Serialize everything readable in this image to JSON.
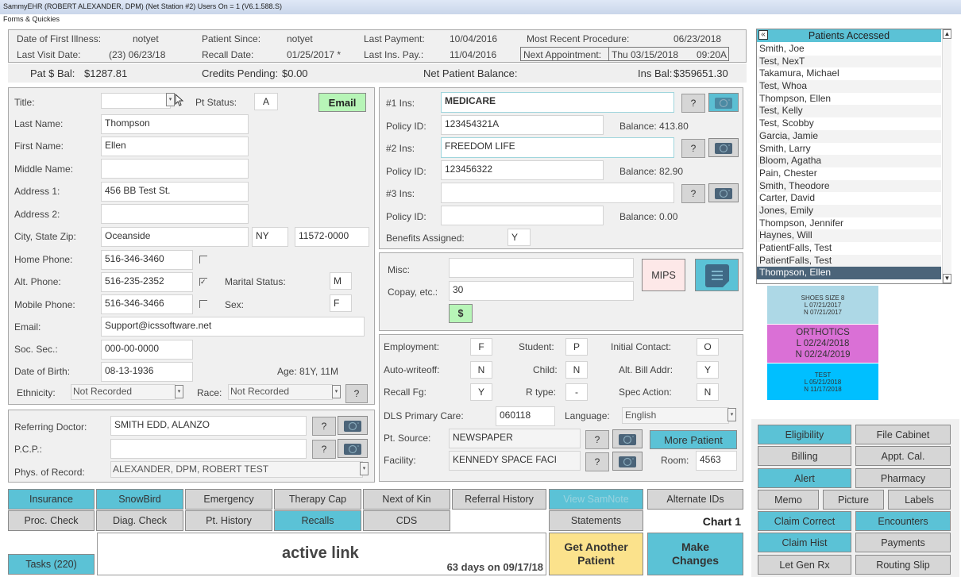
{
  "window": {
    "title": "SammyEHR (ROBERT ALEXANDER, DPM) (Net Station #2)  Users On = 1 (V6.1.588.S)",
    "menu": "Forms & Quickies"
  },
  "summary": {
    "date_first_illness_label": "Date of First Illness:",
    "date_first_illness": "notyet",
    "patient_since_label": "Patient Since:",
    "patient_since": "notyet",
    "last_payment_label": "Last Payment:",
    "last_payment": "10/04/2016",
    "most_recent_proc_label": "Most Recent Procedure:",
    "most_recent_proc": "06/23/2018",
    "last_visit_label": "Last Visit Date:",
    "last_visit": "(23) 06/23/18",
    "recall_date_label": "Recall Date:",
    "recall_date": "01/25/2017 *",
    "last_ins_pay_label": "Last Ins. Pay.:",
    "last_ins_pay": "11/04/2016",
    "next_appt_label": "Next Appointment:",
    "next_appt_date": "Thu 03/15/2018",
    "next_appt_time": "09:20A"
  },
  "balances": {
    "pat_bal_label": "Pat $ Bal:",
    "pat_bal": "$1287.81",
    "credits_label": "Credits Pending:",
    "credits": "$0.00",
    "net_label": "Net Patient Balance:",
    "ins_bal_label": "Ins Bal:",
    "ins_bal": "$359651.30"
  },
  "demographics": {
    "title_label": "Title:",
    "title_value": "",
    "pt_status_label": "Pt Status:",
    "pt_status": "A",
    "email_button": "Email",
    "last_name_label": "Last Name:",
    "last_name": "Thompson",
    "first_name_label": "First Name:",
    "first_name": "Ellen",
    "middle_name_label": "Middle Name:",
    "middle_name": "",
    "address1_label": "Address 1:",
    "address1": "456 BB Test St.",
    "address2_label": "Address 2:",
    "address2": "",
    "city_label": "City, State Zip:",
    "city": "Oceanside",
    "state": "NY",
    "zip": "11572-0000",
    "home_phone_label": "Home Phone:",
    "home_phone": "516-346-3460",
    "home_phone_checked": false,
    "alt_phone_label": "Alt. Phone:",
    "alt_phone": "516-235-2352",
    "alt_phone_checked": true,
    "marital_label": "Marital Status:",
    "marital": "M",
    "mobile_phone_label": "Mobile Phone:",
    "mobile_phone": "516-346-3466",
    "mobile_phone_checked": false,
    "sex_label": "Sex:",
    "sex": "F",
    "email_label": "Email:",
    "email": "Support@icssoftware.net",
    "ssn_label": "Soc. Sec.:",
    "ssn": "000-00-0000",
    "dob_label": "Date of Birth:",
    "dob": "08-13-1936",
    "age": "Age: 81Y, 11M",
    "ethnicity_label": "Ethnicity:",
    "ethnicity": "Not Recorded",
    "race_label": "Race:",
    "race": "Not Recorded",
    "help": "?"
  },
  "doctors": {
    "referring_label": "Referring Doctor:",
    "referring": "SMITH EDD, ALANZO",
    "pcp_label": "P.C.P.:",
    "pcp": "",
    "phys_label": "Phys. of Record:",
    "phys": "ALEXANDER, DPM, ROBERT  TEST",
    "help": "?"
  },
  "insurance": {
    "ins1_label": "#1 Ins:",
    "ins1": "MEDICARE",
    "policy1_label": "Policy ID:",
    "policy1": "123454321A",
    "balance1": "Balance: 413.80",
    "ins2_label": "#2 Ins:",
    "ins2": "FREEDOM LIFE",
    "policy2_label": "Policy ID:",
    "policy2": "123456322",
    "balance2": "Balance: 82.90",
    "ins3_label": "#3 Ins:",
    "ins3": "",
    "policy3_label": "Policy ID:",
    "policy3": "",
    "balance3": "Balance: 0.00",
    "benefits_label": "Benefits Assigned:",
    "benefits": "Y",
    "help": "?"
  },
  "misc": {
    "misc_label": "Misc:",
    "misc": "",
    "copay_label": "Copay, etc.:",
    "copay": "30",
    "dollar_button": "$",
    "mips_button": "MIPS"
  },
  "flags": {
    "employment_label": "Employment:",
    "employment": "F",
    "student_label": "Student:",
    "student": "P",
    "initial_contact_label": "Initial Contact:",
    "initial_contact": "O",
    "autowriteoff_label": "Auto-writeoff:",
    "autowriteoff": "N",
    "child_label": "Child:",
    "child": "N",
    "alt_bill_label": "Alt. Bill Addr:",
    "alt_bill": "Y",
    "recall_fg_label": "Recall Fg:",
    "recall_fg": "Y",
    "rtype_label": "R type:",
    "rtype": "-",
    "spec_action_label": "Spec Action:",
    "spec_action": "N",
    "dls_label": "DLS Primary Care:",
    "dls": "060118",
    "language_label": "Language:",
    "language": "English",
    "source_label": "Pt. Source:",
    "source": "NEWSPAPER",
    "facility_label": "Facility:",
    "facility": "KENNEDY SPACE FACI",
    "more_patient_button": "More Patient",
    "room_label": "Room:",
    "room": "4563",
    "help": "?"
  },
  "patients_accessed": {
    "title": "Patients Accessed",
    "close_glyph": "«",
    "items": [
      "Smith, Joe",
      "Test, NexT",
      "Takamura, Michael",
      "Test, Whoa",
      "Thompson, Ellen",
      "Test, Kelly",
      "Test, Scobby",
      "Garcia, Jamie",
      "Smith, Larry",
      "Bloom, Agatha",
      "Pain, Chester",
      "Smith, Theodore",
      "Carter, David",
      "Jones, Emily",
      "Thompson, Jennifer",
      "Haynes, Will",
      "PatientFalls, Test",
      "PatientFalls, Test",
      "Thompson, Ellen"
    ],
    "selected_index": 18
  },
  "recalls": [
    {
      "name": "SHOES SIZE 8",
      "last": "L 07/21/2017",
      "next": "N 07/21/2017",
      "color": "#add8e6"
    },
    {
      "name": "ORTHOTICS",
      "last": "L 02/24/2018",
      "next": "N 02/24/2019",
      "color": "#da70d6"
    },
    {
      "name": "TEST",
      "last": "L 05/21/2018",
      "next": "N 11/17/2018",
      "color": "#00bfff"
    }
  ],
  "bottom_buttons": {
    "row1": [
      "Insurance",
      "SnowBird",
      "Emergency",
      "Therapy Cap",
      "Next of Kin",
      "Referral History",
      "View SamNote",
      "Alternate IDs"
    ],
    "row2": [
      "Proc. Check",
      "Diag. Check",
      "Pt. History",
      "Recalls",
      "CDS",
      "Statements"
    ],
    "chart": "Chart 1",
    "tasks": "Tasks (220)",
    "active_link": "active link",
    "days": "63 days on 09/17/18",
    "get_another": "Get Another Patient",
    "make_changes": "Make Changes"
  },
  "side_buttons": {
    "eligibility": "Eligibility",
    "file_cabinet": "File Cabinet",
    "billing": "Billing",
    "appt_cal": "Appt. Cal.",
    "alert": "Alert",
    "pharmacy": "Pharmacy",
    "memo": "Memo",
    "picture": "Picture",
    "labels": "Labels",
    "claim_correct": "Claim Correct",
    "encounters": "Encounters",
    "claim_hist": "Claim Hist",
    "payments": "Payments",
    "let_gen_rx": "Let Gen Rx",
    "routing_slip": "Routing Slip"
  },
  "colors": {
    "teal": "#5bc2d6",
    "gray_button": "#d6d6d6",
    "email_green": "#b7f5b7",
    "yellow": "#fbe28c",
    "selected_row": "#4b6479"
  }
}
